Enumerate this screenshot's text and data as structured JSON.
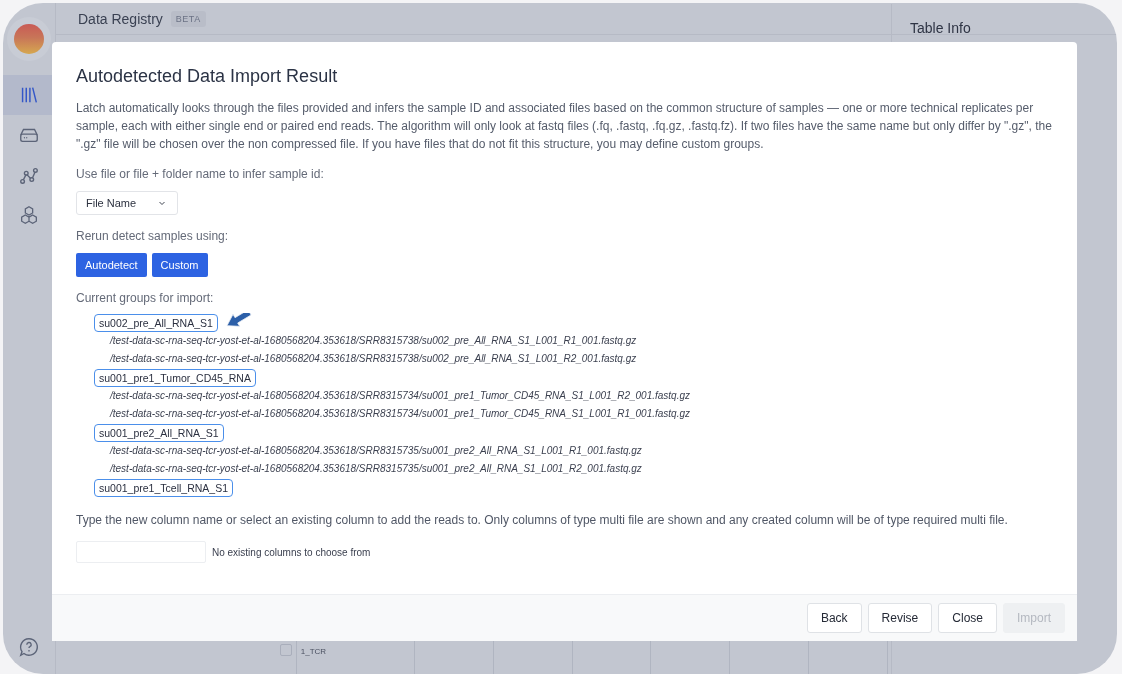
{
  "app": {
    "title": "Data Registry",
    "badge": "BETA",
    "side_panel_title": "Table Info",
    "background_row": {
      "label": "1_TCR",
      "checked": false
    },
    "nav": [
      {
        "selected": true
      },
      {
        "selected": false
      },
      {
        "selected": false
      },
      {
        "selected": false
      }
    ]
  },
  "dialog": {
    "title": "Autodetected Data Import Result",
    "description": "Latch automatically looks through the files provided and infers the sample ID and associated files based on the common structure of samples — one or more technical replicates per sample, each with either single end or paired end reads. The algorithm will only look at fastq files (.fq, .fastq, .fq.gz, .fastq.fz). If two files have the same name but only differ by \".gz\", the \".gz\" file will be chosen over the non compressed file. If you have files that do not fit this structure, you may define custom groups.",
    "infer_label": "Use file or file + folder name to infer sample id:",
    "infer_select": "File Name",
    "rerun_label": "Rerun detect samples using:",
    "rerun_buttons": [
      "Autodetect",
      "Custom"
    ],
    "groups_label": "Current groups for import:",
    "groups": [
      {
        "name": "su002_pre_All_RNA_S1",
        "files": [
          "/test-data-sc-rna-seq-tcr-yost-et-al-1680568204.353618/SRR8315738/su002_pre_All_RNA_S1_L001_R1_001.fastq.gz",
          "/test-data-sc-rna-seq-tcr-yost-et-al-1680568204.353618/SRR8315738/su002_pre_All_RNA_S1_L001_R2_001.fastq.gz"
        ]
      },
      {
        "name": "su001_pre1_Tumor_CD45_RNA",
        "files": [
          "/test-data-sc-rna-seq-tcr-yost-et-al-1680568204.353618/SRR8315734/su001_pre1_Tumor_CD45_RNA_S1_L001_R2_001.fastq.gz",
          "/test-data-sc-rna-seq-tcr-yost-et-al-1680568204.353618/SRR8315734/su001_pre1_Tumor_CD45_RNA_S1_L001_R1_001.fastq.gz"
        ]
      },
      {
        "name": "su001_pre2_All_RNA_S1",
        "files": [
          "/test-data-sc-rna-seq-tcr-yost-et-al-1680568204.353618/SRR8315735/su001_pre2_All_RNA_S1_L001_R1_001.fastq.gz",
          "/test-data-sc-rna-seq-tcr-yost-et-al-1680568204.353618/SRR8315735/su001_pre2_All_RNA_S1_L001_R2_001.fastq.gz"
        ]
      },
      {
        "name": "su001_pre1_Tcell_RNA_S1"
      }
    ],
    "column_label": "Type the new column name or select an existing column to add the reads to. Only columns of type multi file are shown and any created column will be of type required multi file.",
    "column_hint": "No existing columns to choose from",
    "footer_buttons": [
      {
        "label": "Back",
        "disabled": false
      },
      {
        "label": "Revise",
        "disabled": false
      },
      {
        "label": "Close",
        "disabled": false
      },
      {
        "label": "Import",
        "disabled": true
      }
    ]
  }
}
